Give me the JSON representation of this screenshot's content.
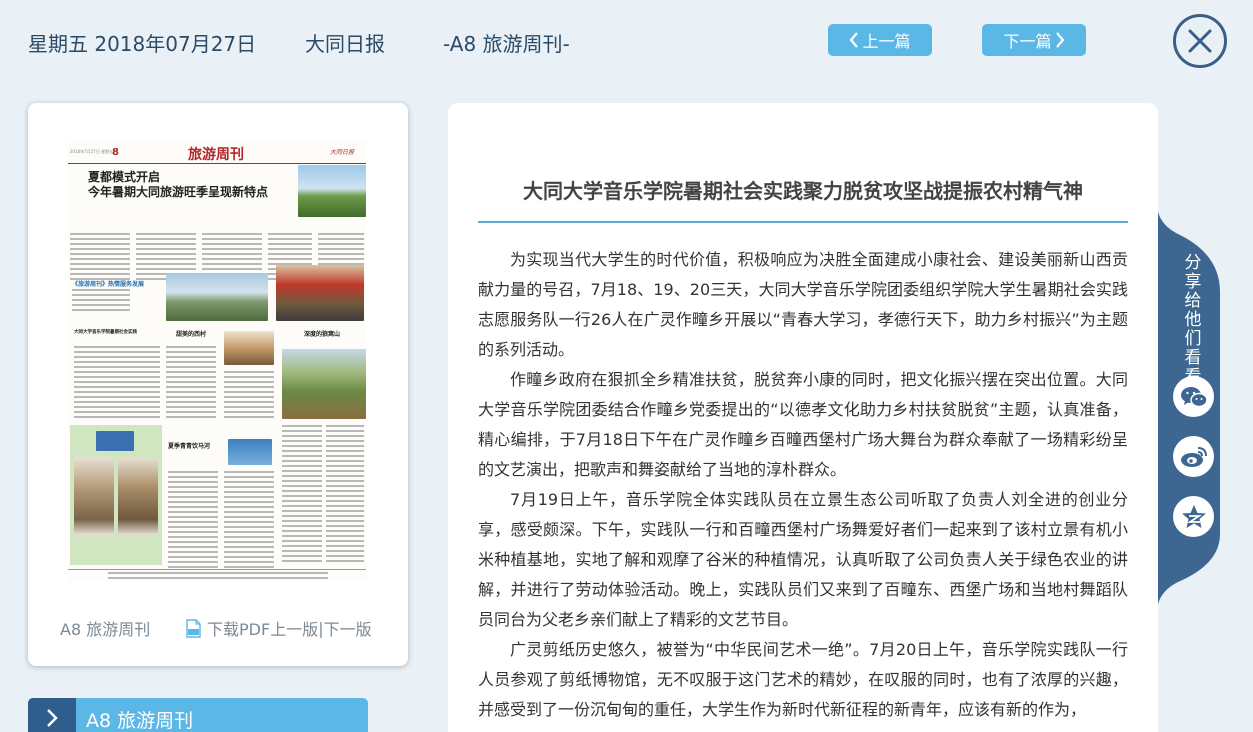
{
  "header": {
    "date": "星期五 2018年07月27日",
    "paper": "大同日报",
    "edition": "-A8 旅游周刊-",
    "prev_label": "上一篇",
    "next_label": "下一篇"
  },
  "page_card": {
    "thumbnail": {
      "page_number": "8",
      "section_title": "旅游周刊",
      "masthead": "大同日报",
      "headline_1": "夏都模式开启",
      "headline_2": "今年暑期大同旅游旺季呈现新特点",
      "sub_heading_1": "大同大学音乐学院暑期社会实践聚力脱贫攻坚战提振农村精气神",
      "sub_heading_2": "甜美的西村",
      "sub_heading_3": "深度的狼窝山",
      "sub_heading_4": "夏季青青饮马河",
      "promo_text": "《旅游周刊》热情服务发展"
    },
    "edition_label": "A8 旅游周刊",
    "download_pdf": "下载PDF",
    "prev_page": "上一版",
    "separator": " |",
    "next_page": "下一版"
  },
  "edition_tab": {
    "label": "A8  旅游周刊"
  },
  "article": {
    "title": "大同大学音乐学院暑期社会实践聚力脱贫攻坚战提振农村精气神",
    "paragraphs": [
      "为实现当代大学生的时代价值，积极响应为决胜全面建成小康社会、建设美丽新山西贡献力量的号召，7月18、19、20三天，大同大学音乐学院团委组织学院大学生暑期社会实践志愿服务队一行26人在广灵作疃乡开展以“青春大学习，孝德行天下，助力乡村振兴”为主题的系列活动。",
      "作疃乡政府在狠抓全乡精准扶贫，脱贫奔小康的同时，把文化振兴摆在突出位置。大同大学音乐学院团委结合作疃乡党委提出的“以德孝文化助力乡村扶贫脱贫”主题，认真准备，精心编排，于7月18日下午在广灵作疃乡百疃西堡村广场大舞台为群众奉献了一场精彩纷呈的文艺演出，把歌声和舞姿献给了当地的淳朴群众。",
      "7月19日上午，音乐学院全体实践队员在立景生态公司听取了负责人刘全进的创业分享，感受颇深。下午，实践队一行和百疃西堡村广场舞爱好者们一起来到了该村立景有机小米种植基地，实地了解和观摩了谷米的种植情况，认真听取了公司负责人关于绿色农业的讲解，并进行了劳动体验活动。晚上，实践队员们又来到了百疃东、西堡广场和当地村舞蹈队员同台为父老乡亲们献上了精彩的文艺节目。",
      "广灵剪纸历史悠久，被誉为“中华民间艺术一绝”。7月20日上午，音乐学院实践队一行人员参观了剪纸博物馆，无不叹服于这门艺术的精妙，在叹服的同时，也有了浓厚的兴趣，并感受到了一份沉甸甸的重任，大学生作为新时代新征程的新青年，应该有新的作为，"
    ]
  },
  "share": {
    "label": "分享给他们看看",
    "buttons": [
      "wechat-icon",
      "weibo-icon",
      "qzone-icon"
    ]
  },
  "colors": {
    "background": "#e9f1f7",
    "accent": "#5bb8e6",
    "dark_blue": "#2f5d8c",
    "share_panel": "#3d6690",
    "title_rule": "#5aa9d0"
  }
}
